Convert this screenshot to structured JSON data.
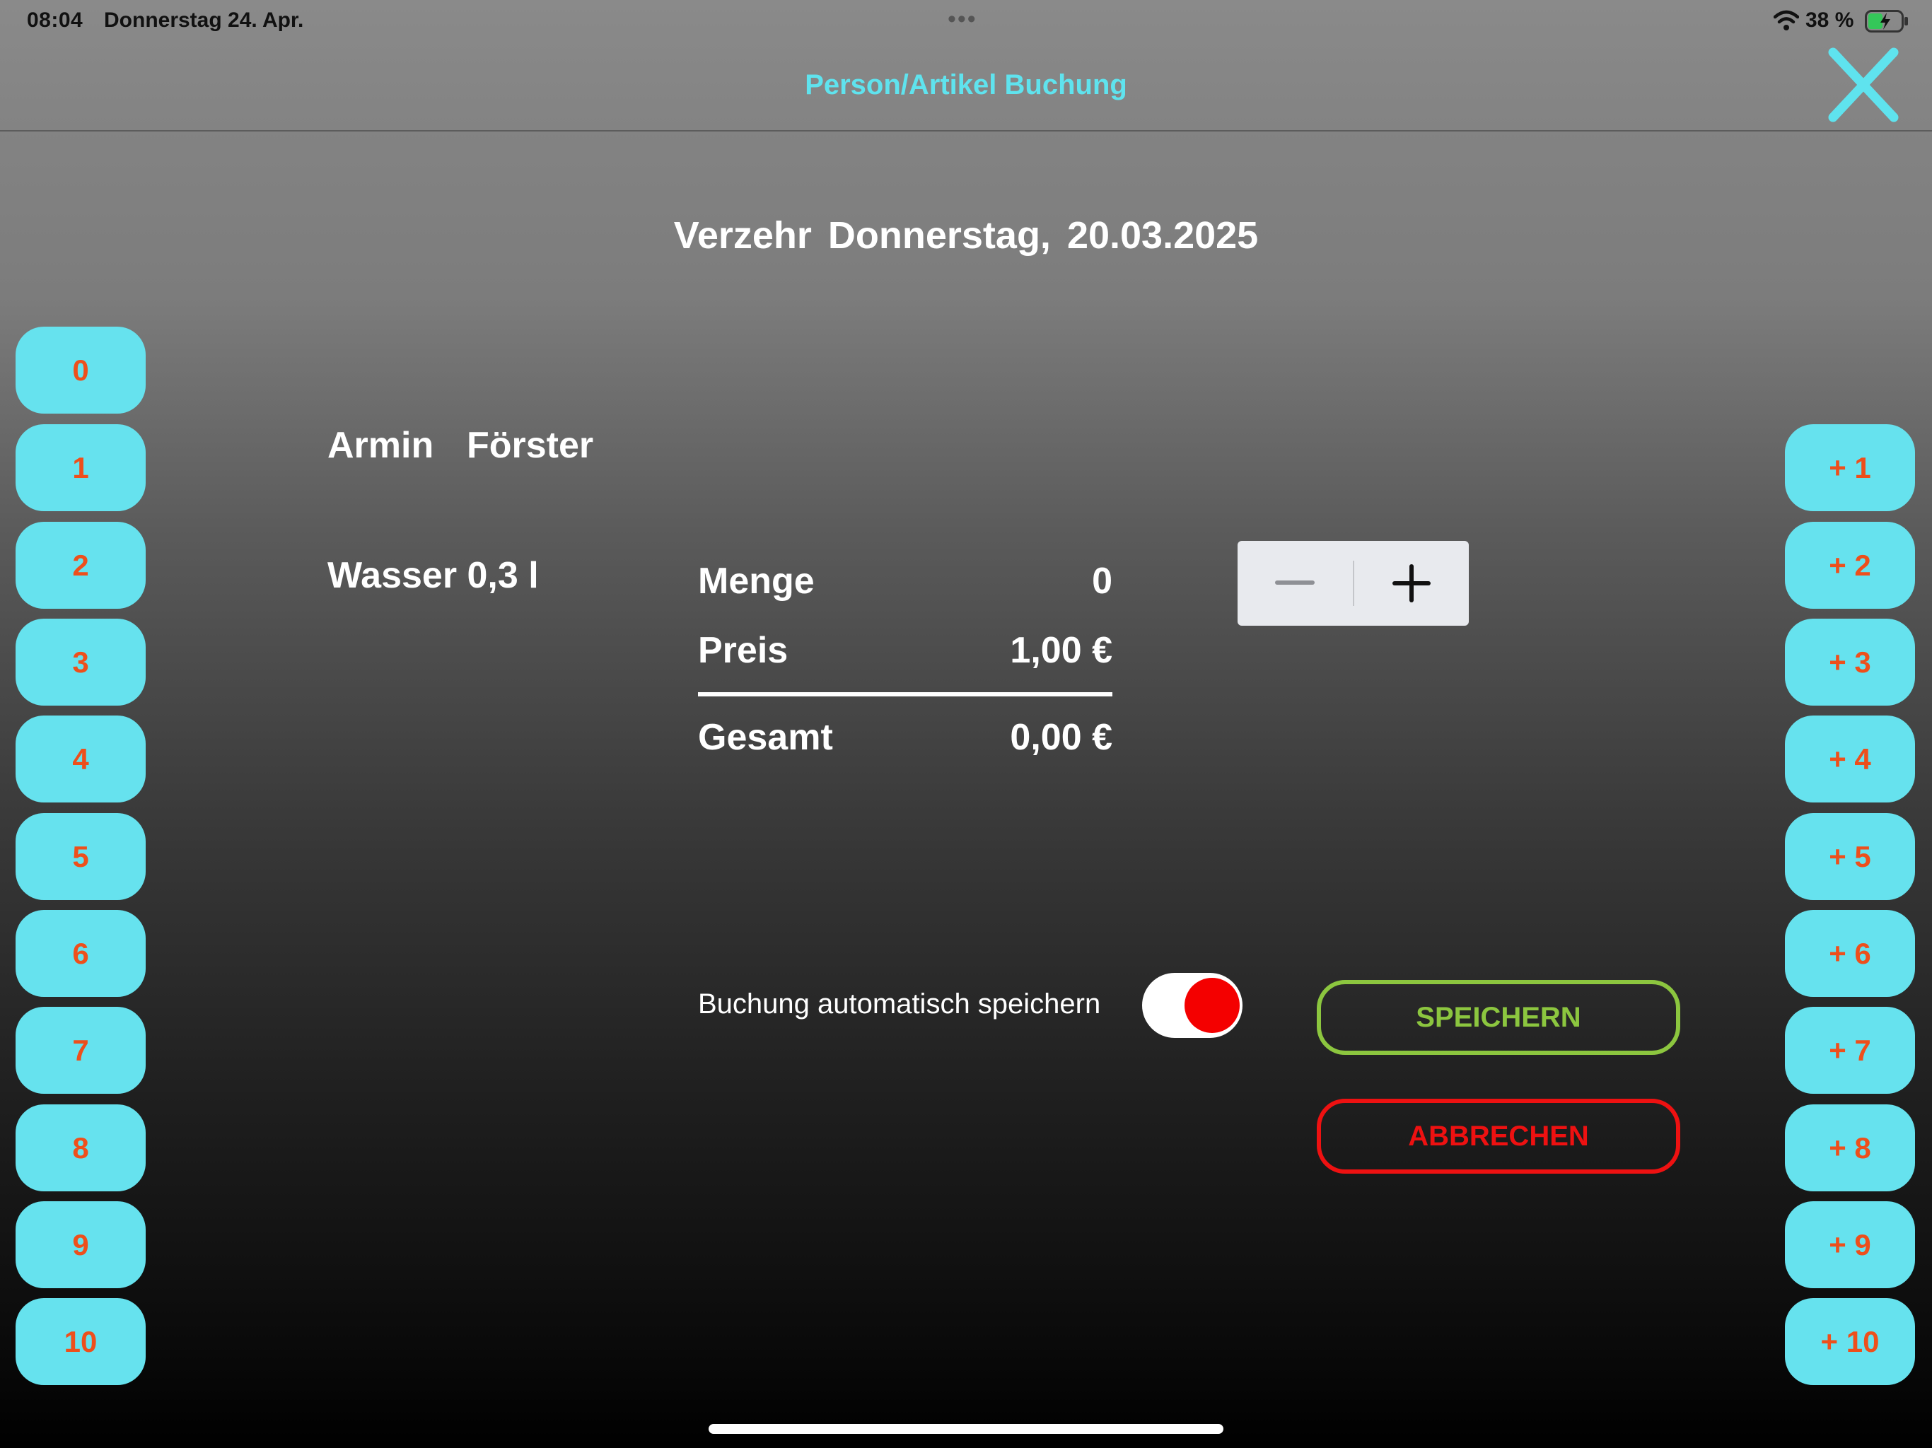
{
  "status_bar": {
    "time": "08:04",
    "date": "Donnerstag 24. Apr.",
    "dots": "•••",
    "battery": "38 %"
  },
  "header": {
    "title": "Person/Artikel Buchung"
  },
  "page": {
    "title": "Verzehr  Donnerstag, 20.03.2025"
  },
  "person": {
    "first_name": "Armin",
    "last_name": "Förster"
  },
  "article": {
    "name": "Wasser 0,3 l"
  },
  "summary": {
    "quantity_label": "Menge",
    "quantity_value": "0",
    "price_label": "Preis",
    "price_value": "1,00 €",
    "total_label": "Gesamt",
    "total_value": "0,00 €"
  },
  "toggle": {
    "label": "Buchung automatisch speichern",
    "on": true
  },
  "actions": {
    "save_label": "SPEICHERN",
    "cancel_label": "ABBRECHEN"
  },
  "set_buttons": [
    "0",
    "1",
    "2",
    "3",
    "4",
    "5",
    "6",
    "7",
    "8",
    "9",
    "10"
  ],
  "add_buttons": [
    "+ 1",
    "+ 2",
    "+ 3",
    "+ 4",
    "+ 5",
    "+ 6",
    "+ 7",
    "+ 8",
    "+ 9",
    "+ 10"
  ],
  "colors": {
    "accent": "#66e2ee",
    "button_text": "#ee4f1b",
    "save": "#8cc63f",
    "cancel": "#ee1111",
    "toggle_knob": "#f40000"
  }
}
